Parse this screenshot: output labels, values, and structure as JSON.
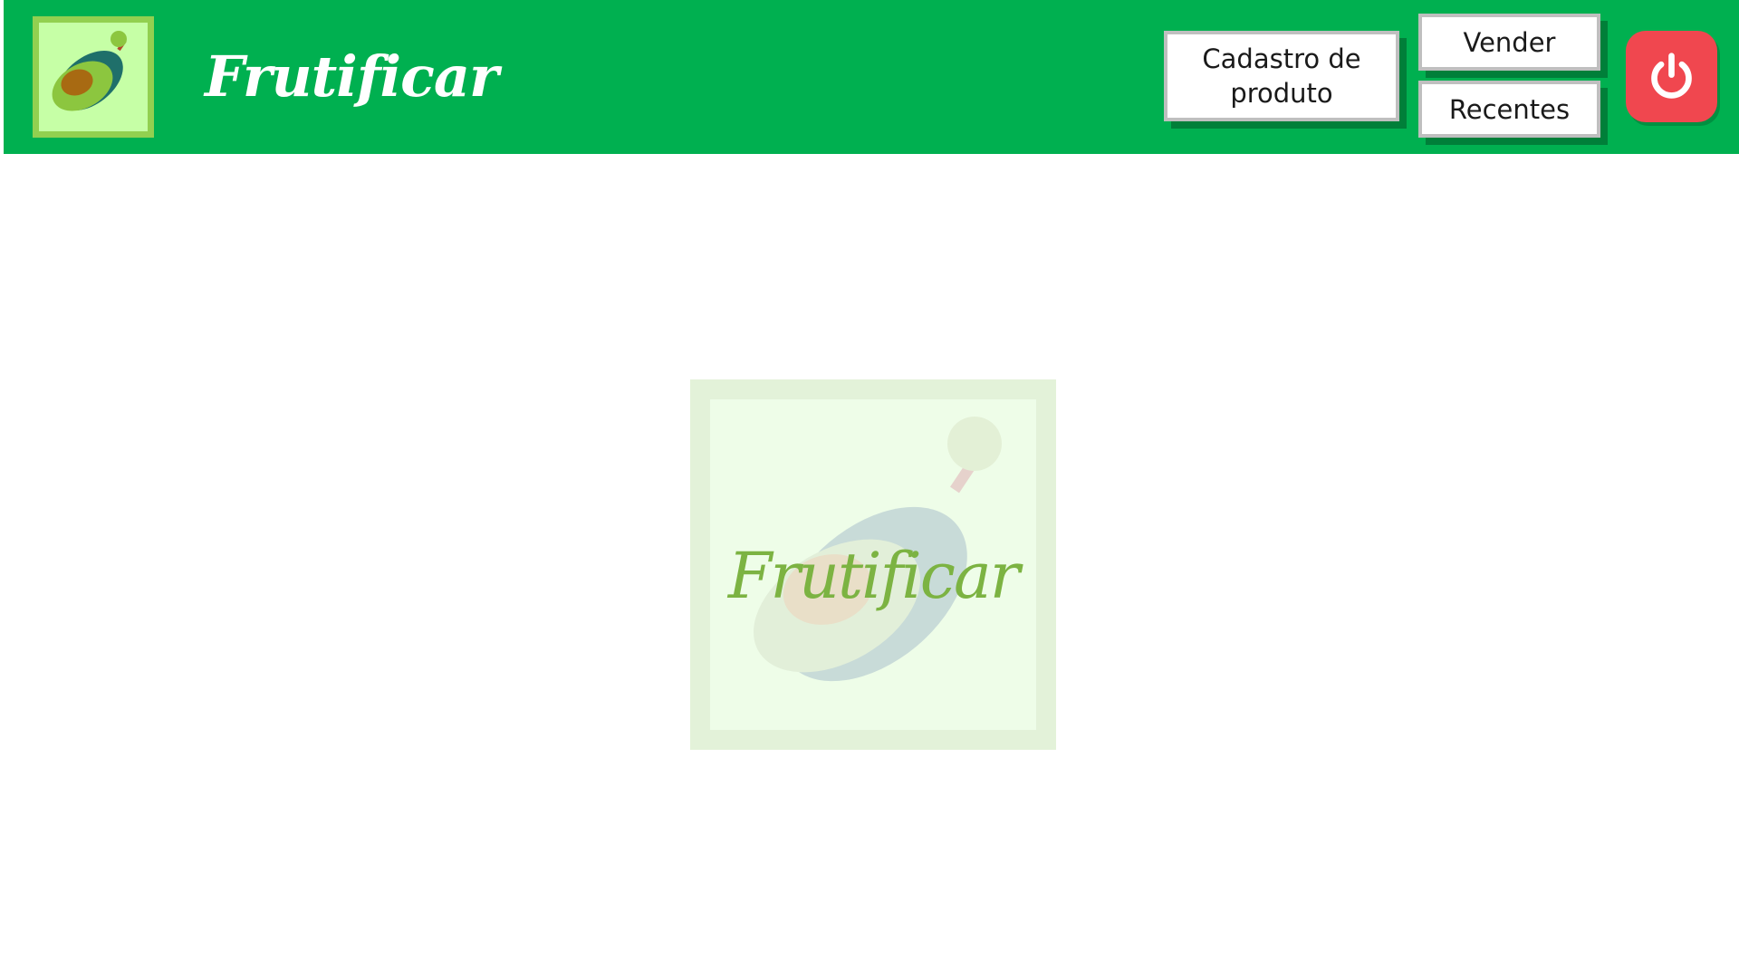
{
  "header": {
    "title": "Frutificar",
    "logo_icon": "avocado-logo-icon",
    "background_color": "#00b050"
  },
  "nav": {
    "cadastro_label": "Cadastro de produto",
    "vender_label": "Vender",
    "recentes_label": "Recentes"
  },
  "power": {
    "icon": "power-icon",
    "color": "#f0474f"
  },
  "main": {
    "watermark_text": "Frutificar",
    "watermark_icon": "avocado-watermark-icon"
  }
}
